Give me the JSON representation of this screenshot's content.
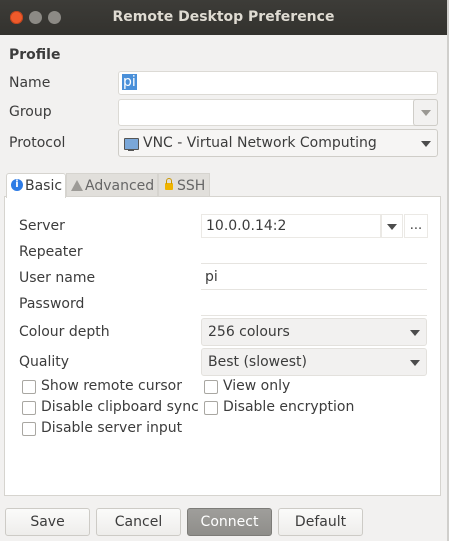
{
  "window": {
    "title": "Remote Desktop Preference"
  },
  "profile": {
    "section_title": "Profile",
    "name_label": "Name",
    "name_value": "pi",
    "group_label": "Group",
    "group_value": "",
    "protocol_label": "Protocol",
    "protocol_value": "VNC - Virtual Network Computing"
  },
  "tabs": [
    {
      "label": "Basic",
      "icon": "info-icon",
      "active": true
    },
    {
      "label": "Advanced",
      "icon": "warning-icon",
      "active": false
    },
    {
      "label": "SSH",
      "icon": "lock-icon",
      "active": false
    }
  ],
  "basic": {
    "server_label": "Server",
    "server_value": "10.0.0.14:2",
    "browse_label": "...",
    "repeater_label": "Repeater",
    "repeater_value": "",
    "username_label": "User name",
    "username_value": "pi",
    "password_label": "Password",
    "password_value": "",
    "colour_depth_label": "Colour depth",
    "colour_depth_value": "256 colours",
    "quality_label": "Quality",
    "quality_value": "Best (slowest)",
    "checks": [
      {
        "label": "Show remote cursor",
        "checked": false
      },
      {
        "label": "View only",
        "checked": false
      },
      {
        "label": "Disable clipboard sync",
        "checked": false
      },
      {
        "label": "Disable encryption",
        "checked": false
      },
      {
        "label": "Disable server input",
        "checked": false
      }
    ]
  },
  "buttons": {
    "save": "Save",
    "cancel": "Cancel",
    "connect": "Connect",
    "default": "Default"
  },
  "colors": {
    "titlebar": "#3c3b37",
    "close_button": "#ee5a2b",
    "accent": "#4a90d9",
    "info_icon": "#2d7be5",
    "lock_icon": "#f0b400"
  }
}
